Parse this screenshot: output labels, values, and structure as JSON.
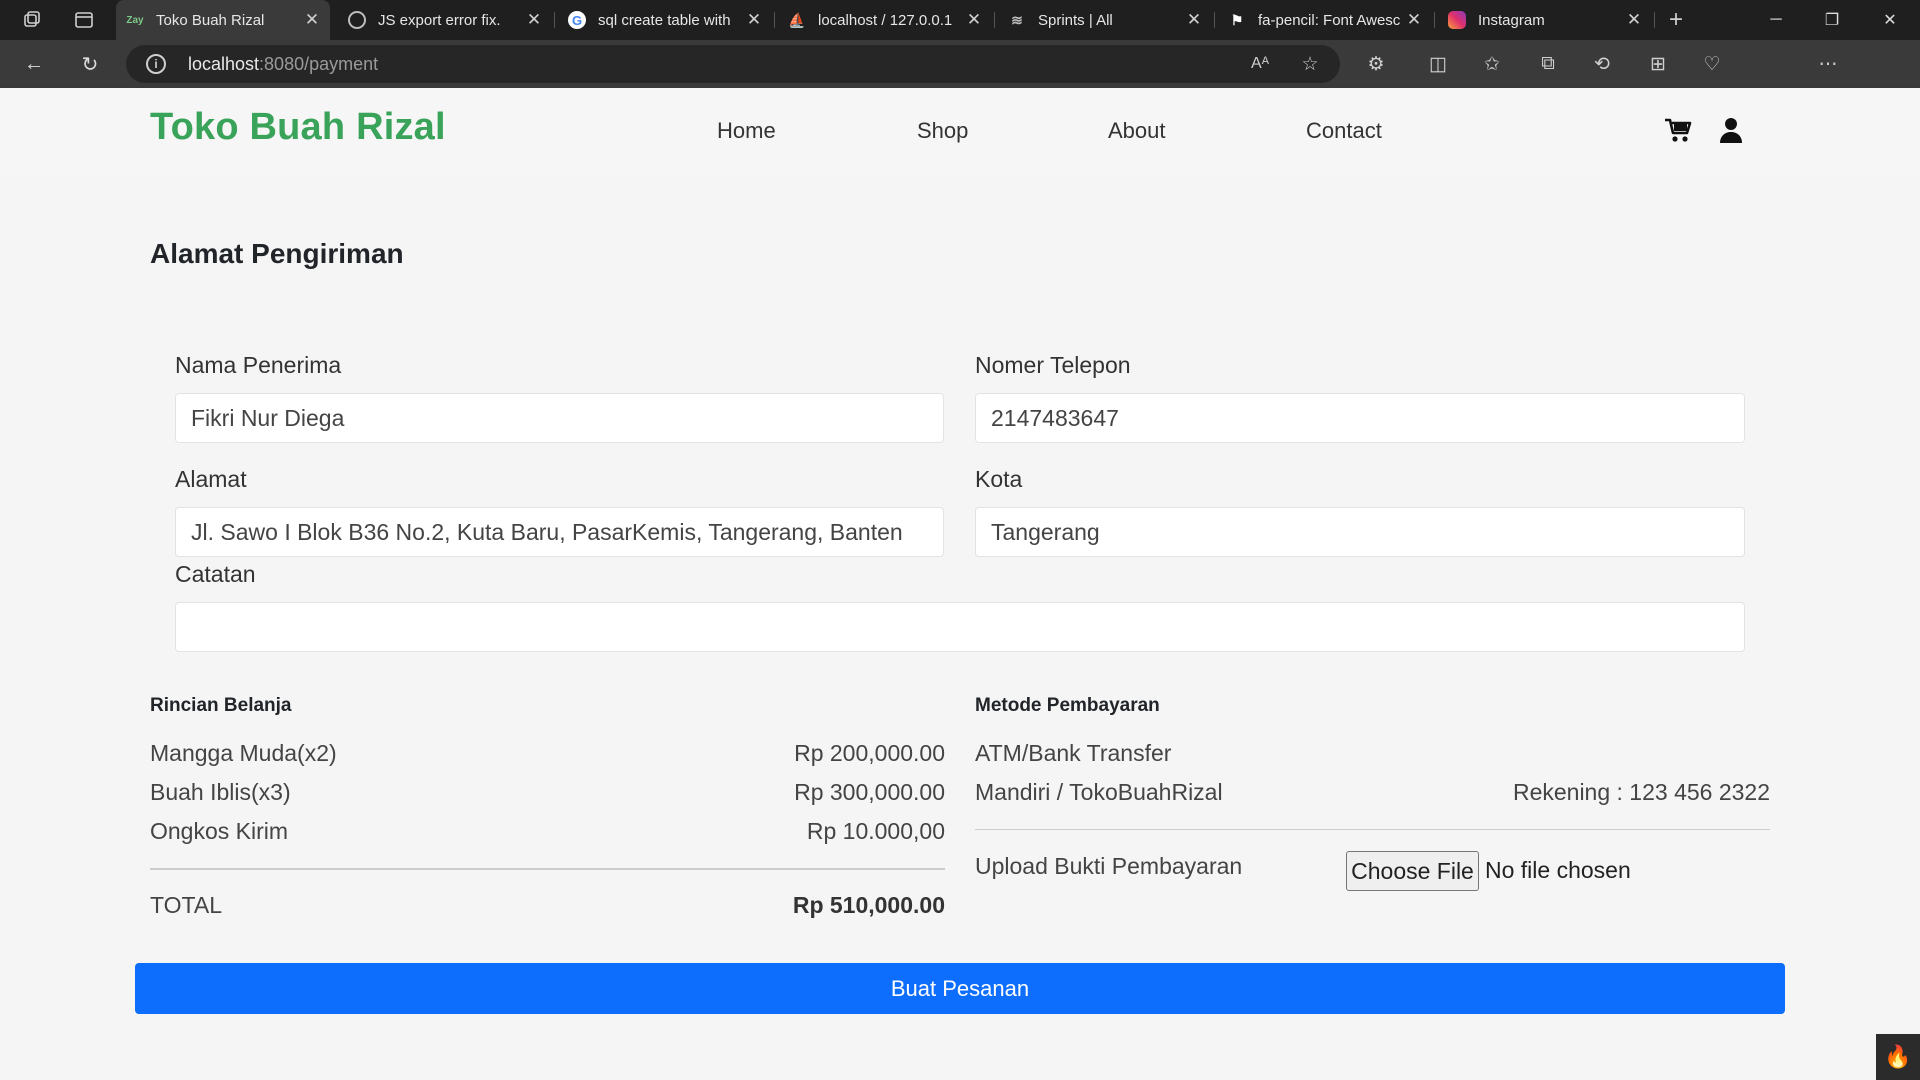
{
  "browser": {
    "tabs": [
      {
        "title": "Toko Buah Rizal",
        "favicon": "Zay",
        "active": true
      },
      {
        "title": "JS export error fix.",
        "favicon": "chatgpt-icon"
      },
      {
        "title": "sql create table with",
        "favicon": "google-icon"
      },
      {
        "title": "localhost / 127.0.0.1",
        "favicon": "phpmyadmin-icon"
      },
      {
        "title": "Sprints | All",
        "favicon": "database-icon"
      },
      {
        "title": "fa-pencil: Font Awesc",
        "favicon": "flag-icon"
      },
      {
        "title": "Instagram",
        "favicon": "instagram-icon"
      }
    ],
    "url_host": "localhost",
    "url_path": ":8080/payment"
  },
  "site": {
    "brand": "Toko Buah Rizal",
    "nav": [
      "Home",
      "Shop",
      "About",
      "Contact"
    ],
    "brand_color": "#3aa35a"
  },
  "form": {
    "title": "Alamat Pengiriman",
    "name_label": "Nama Penerima",
    "name_value": "Fikri Nur Diega",
    "phone_label": "Nomer Telepon",
    "phone_value": "2147483647",
    "address_label": "Alamat",
    "address_value": "Jl. Sawo I Blok B36 No.2, Kuta Baru, PasarKemis, Tangerang, Banten",
    "city_label": "Kota",
    "city_value": "Tangerang",
    "notes_label": "Catatan",
    "notes_value": ""
  },
  "summary": {
    "heading": "Rincian Belanja",
    "items": [
      {
        "name": "Mangga Muda(x2)",
        "price": "Rp 200,000.00"
      },
      {
        "name": "Buah Iblis(x3)",
        "price": "Rp 300,000.00"
      },
      {
        "name": "Ongkos Kirim",
        "price": "Rp 10.000,00"
      }
    ],
    "total_label": "TOTAL",
    "total_value": "Rp 510,000.00"
  },
  "payment": {
    "heading": "Metode Pembayaran",
    "method": "ATM/Bank Transfer",
    "bank": "Mandiri / TokoBuahRizal",
    "account": "Rekening : 123 456 2322",
    "upload_label": "Upload Bukti Pembayaran",
    "file_button": "Choose File",
    "file_status": "No file chosen"
  },
  "submit_label": "Buat Pesanan",
  "accent": "#0d6efd"
}
